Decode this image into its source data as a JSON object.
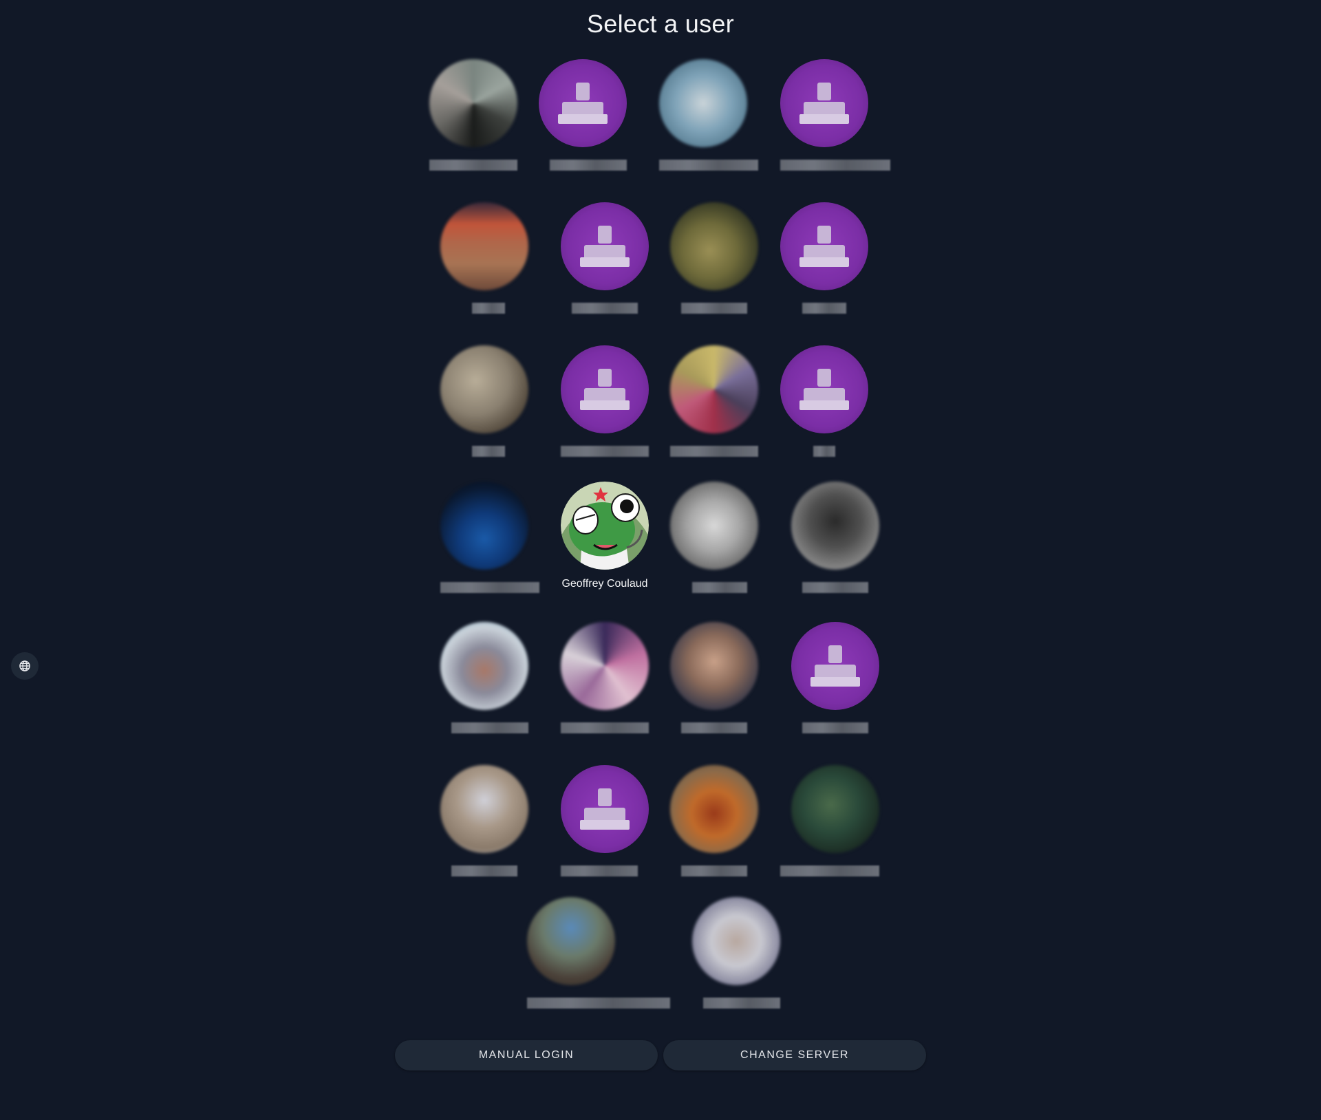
{
  "page": {
    "title": "Select a user"
  },
  "users": {
    "highlighted_name": "Geoffrey Coulaud"
  },
  "actions": {
    "manual_login": "MANUAL LOGIN",
    "change_server": "CHANGE SERVER"
  },
  "icons": {
    "language": "globe-icon",
    "placeholder": "user-placeholder-icon"
  },
  "colors": {
    "background": "#111827",
    "button": "#1f2937",
    "placeholder_avatar": "#7b2ea6"
  }
}
